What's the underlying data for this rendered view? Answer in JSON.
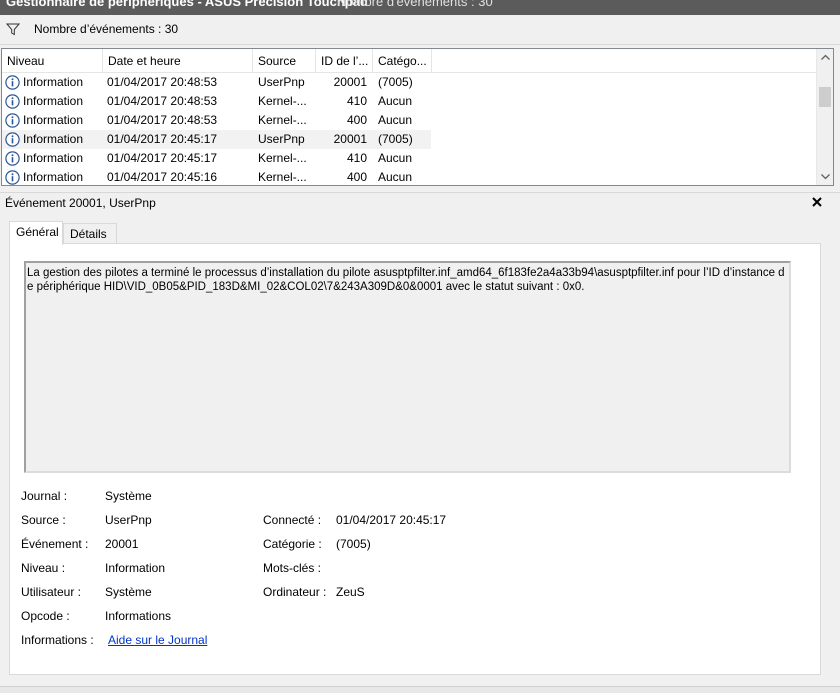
{
  "window": {
    "title": "Gestionnaire de périphériques - ASUS Precision Touchpad",
    "subtitle": "Nombre d'événements : 30"
  },
  "filter": {
    "count_text": "Nombre d’événements : 30"
  },
  "grid": {
    "columns": [
      "Niveau",
      "Date et heure",
      "Source",
      "ID de l’...",
      "Catégo..."
    ],
    "rows": [
      {
        "level": "Information",
        "date": "01/04/2017 20:48:53",
        "source": "UserPnp",
        "id": "20001",
        "category": "(7005)"
      },
      {
        "level": "Information",
        "date": "01/04/2017 20:48:53",
        "source": "Kernel-...",
        "id": "410",
        "category": "Aucun"
      },
      {
        "level": "Information",
        "date": "01/04/2017 20:48:53",
        "source": "Kernel-...",
        "id": "400",
        "category": "Aucun"
      },
      {
        "level": "Information",
        "date": "01/04/2017 20:45:17",
        "source": "UserPnp",
        "id": "20001",
        "category": "(7005)"
      },
      {
        "level": "Information",
        "date": "01/04/2017 20:45:17",
        "source": "Kernel-...",
        "id": "410",
        "category": "Aucun"
      },
      {
        "level": "Information",
        "date": "01/04/2017 20:45:16",
        "source": "Kernel-...",
        "id": "400",
        "category": "Aucun"
      }
    ],
    "selected_row": 3
  },
  "details": {
    "title": "Événement 20001, UserPnp",
    "close": "×",
    "tabs": [
      "Général",
      "Détails"
    ],
    "description": "La gestion des pilotes a terminé le processus d’installation du pilote asusptpfilter.inf_amd64_6f183fe2a4a33b94\\asusptpfilter.inf pour l’ID d’instance de périphérique HID\\VID_0B05&PID_183D&MI_02&COL02\\7&243A309D&0&0001 avec le statut suivant : 0x0.",
    "fields": {
      "journal_label": "Journal :",
      "journal_value": "Système",
      "source_label": "Source :",
      "source_value": "UserPnp",
      "event_label": "Événement :",
      "event_value": "20001",
      "level_label": "Niveau :",
      "level_value": "Information",
      "user_label": "Utilisateur :",
      "user_value": "Système",
      "opcode_label": "Opcode :",
      "opcode_value": "Informations",
      "info_label": "Informations :",
      "info_link": "Aide sur le Journal",
      "logged_label": "Connecté :",
      "logged_value": "01/04/2017 20:45:17",
      "category_label": "Catégorie :",
      "category_value": "(7005)",
      "keywords_label": "Mots-clés :",
      "keywords_value": "",
      "computer_label": "Ordinateur :",
      "computer_value": "ZeuS"
    }
  },
  "colors": {
    "titlebar": "#5b5b5b",
    "info_icon": "#2b5797",
    "link": "#0033cc",
    "selection": "#f2f2f2"
  },
  "icons": [
    "filter-icon",
    "info-icon",
    "scroll-up-icon",
    "scroll-down-icon",
    "close-icon"
  ]
}
